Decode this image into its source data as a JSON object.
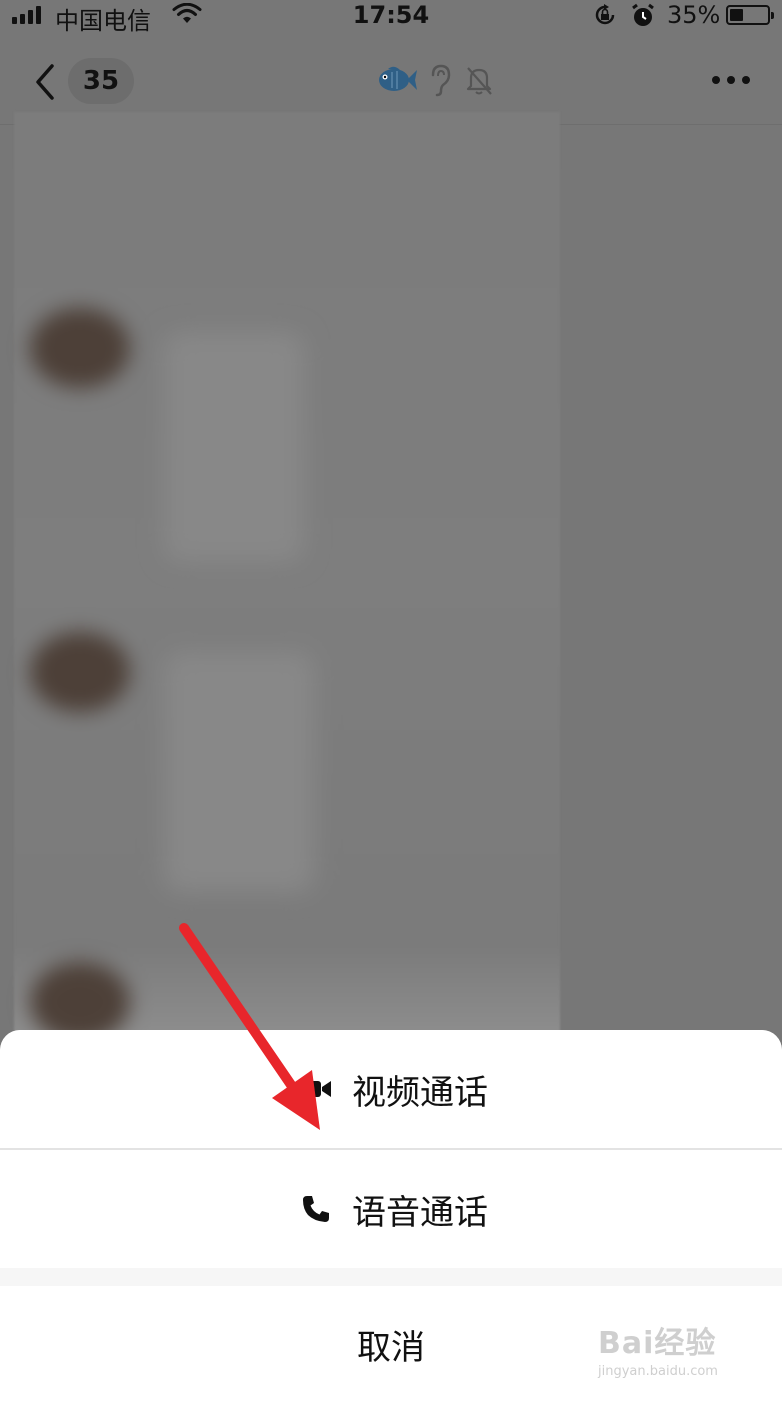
{
  "status_bar": {
    "carrier": "中国电信",
    "time": "17:54",
    "battery_percent": "35%",
    "battery_level": 0.35,
    "icons": [
      "signal-icon",
      "wifi-icon",
      "rotation-lock-icon",
      "alarm-icon",
      "battery-icon"
    ]
  },
  "nav": {
    "back_count": "35",
    "title_icons": [
      "fish-icon",
      "ear-icon",
      "mute-bell-icon"
    ],
    "more_icon": "more-icon"
  },
  "sheet": {
    "video_call_label": "视频通话",
    "voice_call_label": "语音通话",
    "cancel_label": "取消"
  },
  "annotation": {
    "arrow_color": "#e8262b"
  },
  "watermark": {
    "logo": "Bai经验",
    "url": "jingyan.baidu.com"
  }
}
